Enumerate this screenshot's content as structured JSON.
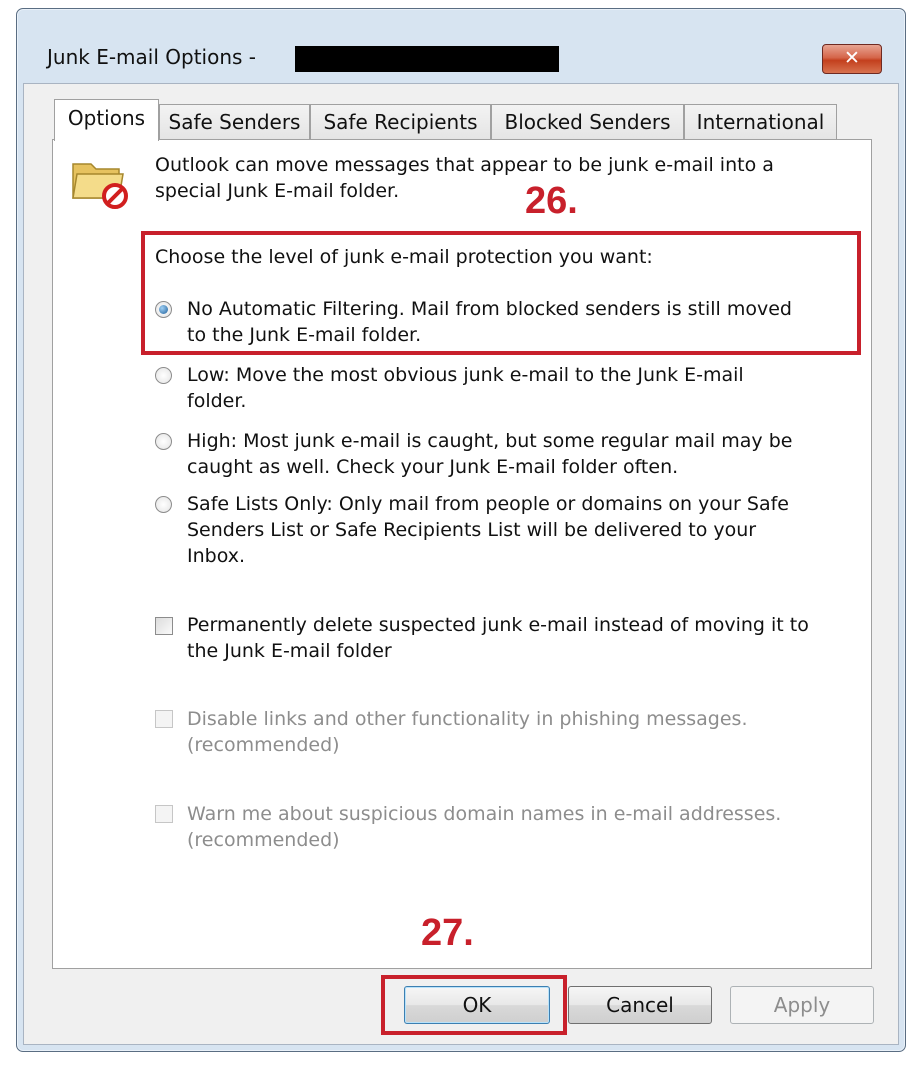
{
  "window": {
    "title": "Junk E-mail Options -",
    "close_glyph": "✕"
  },
  "tabs": [
    {
      "label": "Options",
      "active": true
    },
    {
      "label": "Safe Senders"
    },
    {
      "label": "Safe Recipients"
    },
    {
      "label": "Blocked Senders"
    },
    {
      "label": "International"
    }
  ],
  "intro": {
    "icon": "junk-folder-icon",
    "line1": "Outlook can move messages that appear to be junk e-mail into a",
    "line2": "special Junk E-mail folder."
  },
  "protection": {
    "heading": "Choose the level of junk e-mail protection you want:",
    "options": [
      {
        "lines": [
          "No Automatic Filtering. Mail from blocked senders is still moved",
          "to the Junk E-mail folder."
        ],
        "checked": true
      },
      {
        "lines": [
          "Low: Move the most obvious junk e-mail to the Junk E-mail",
          "folder."
        ],
        "checked": false
      },
      {
        "lines": [
          "High: Most junk e-mail is caught, but some regular mail may be",
          "caught as well. Check your Junk E-mail folder often."
        ],
        "checked": false
      },
      {
        "lines": [
          "Safe Lists Only: Only mail from people or domains on your Safe",
          "Senders List or Safe Recipients List will be delivered to your",
          "Inbox."
        ],
        "checked": false
      }
    ]
  },
  "checkboxes": [
    {
      "lines": [
        "Permanently delete suspected junk e-mail instead of moving it to",
        "the Junk E-mail folder"
      ],
      "checked": false,
      "disabled": false
    },
    {
      "lines": [
        "Disable links and other functionality in phishing messages.",
        "(recommended)"
      ],
      "checked": false,
      "disabled": true
    },
    {
      "lines": [
        "Warn me about suspicious domain names in e-mail addresses.",
        "(recommended)"
      ],
      "checked": false,
      "disabled": true
    }
  ],
  "annotations": {
    "step1": "26.",
    "step2": "27."
  },
  "buttons": {
    "ok": "OK",
    "cancel": "Cancel",
    "apply": "Apply"
  },
  "colors": {
    "annotation": "#c8202b",
    "titlebar": "#d7e4f1",
    "close": "#c33f1d"
  }
}
